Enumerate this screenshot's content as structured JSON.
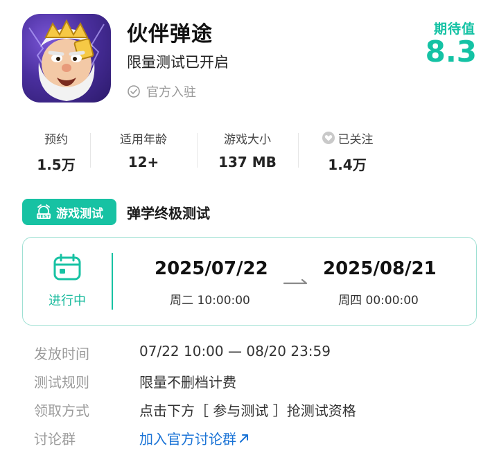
{
  "app": {
    "title": "伙伴弹途",
    "subtitle": "限量测试已开启",
    "verified_label": "官方入驻",
    "icon": "game-app-icon"
  },
  "expectation": {
    "label": "期待值",
    "score": "8.3"
  },
  "stats": [
    {
      "label": "预约",
      "value": "1.5万"
    },
    {
      "label": "适用年龄",
      "value": "12+"
    },
    {
      "label": "游戏大小",
      "value": "137 MB"
    },
    {
      "label": "已关注",
      "value": "1.4万",
      "icon": "heart-icon"
    }
  ],
  "test": {
    "tag_label": "游戏测试",
    "name": "弹学终极测试"
  },
  "period": {
    "status": "进行中",
    "start_date": "2025/07/22",
    "start_time": "周二  10:00:00",
    "end_date": "2025/08/21",
    "end_time": "周四  00:00:00"
  },
  "details": [
    {
      "label": "发放时间",
      "value": "07/22 10:00 — 08/20 23:59"
    },
    {
      "label": "测试规则",
      "value": "限量不删档计费"
    },
    {
      "label": "领取方式",
      "value": "点击下方［ 参与测试 ］抢测试资格"
    },
    {
      "label": "讨论群",
      "value": "加入官方讨论群"
    }
  ],
  "colors": {
    "accent": "#17c2a3",
    "link": "#1a73d6",
    "muted": "#9b9b9b"
  }
}
